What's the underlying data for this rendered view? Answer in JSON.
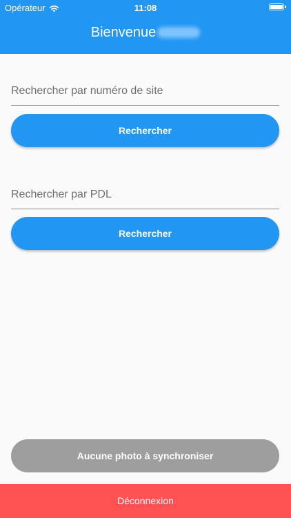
{
  "status_bar": {
    "carrier": "Opérateur",
    "time": "11:08"
  },
  "header": {
    "title": "Bienvenue"
  },
  "search_site": {
    "placeholder": "Rechercher par numéro de site",
    "value": "",
    "button_label": "Rechercher"
  },
  "search_pdl": {
    "placeholder": "Rechercher par PDL",
    "value": "",
    "button_label": "Rechercher"
  },
  "sync": {
    "label": "Aucune photo à synchroniser"
  },
  "logout": {
    "label": "Déconnexion"
  },
  "colors": {
    "primary": "#2196f3",
    "sync_button": "#9e9e9e",
    "logout": "#ff5252",
    "background": "#fafafa"
  },
  "icons": {
    "wifi": "wifi-icon",
    "battery": "battery-icon"
  }
}
